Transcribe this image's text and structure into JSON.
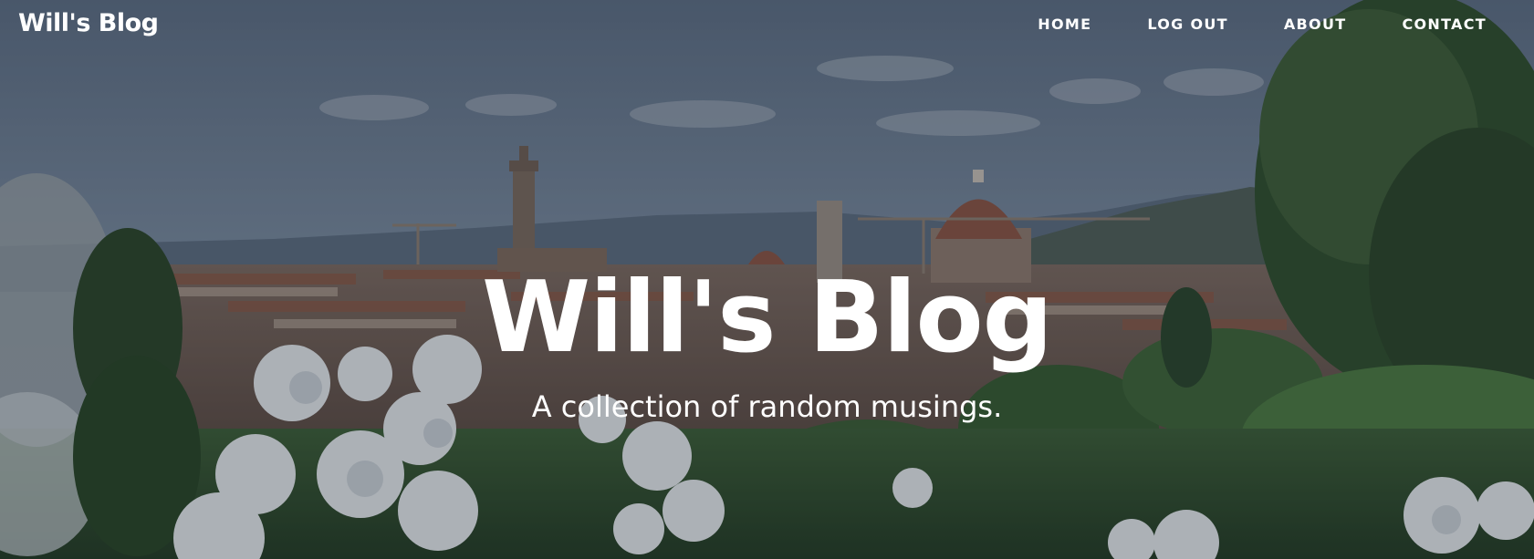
{
  "navbar": {
    "brand": "Will's Blog",
    "links": [
      {
        "label": "HOME"
      },
      {
        "label": "LOG OUT"
      },
      {
        "label": "ABOUT"
      },
      {
        "label": "CONTACT"
      }
    ]
  },
  "header": {
    "title": "Will's Blog",
    "subtitle": "A collection of random musings."
  },
  "background": {
    "description_icon": "city-skyline-photo",
    "colors": {
      "sky": "#6f8196",
      "hills": "#5a6b7e",
      "roofs": "#8a5a46",
      "greenery": "#3f6b3a",
      "flowers": "#e8ecef"
    }
  }
}
